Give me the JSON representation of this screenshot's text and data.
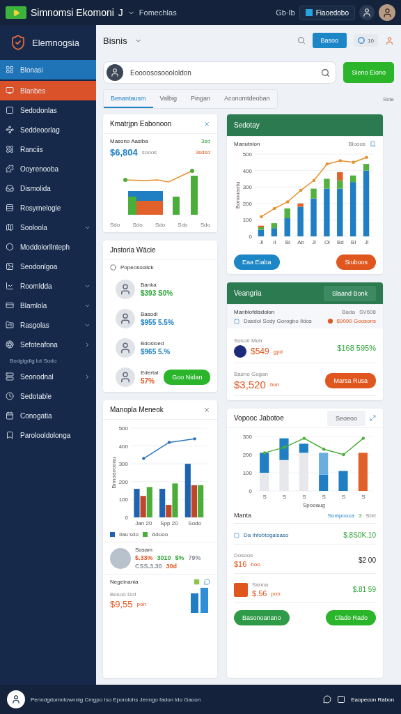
{
  "topbar": {
    "title": "Simnomsi Ekomoni",
    "suffix": "J",
    "subtitle": "Fomechlas",
    "status": "Gb·Ib",
    "action": "Fiaoedobo"
  },
  "sidebar": {
    "brand": "Elemnogsia",
    "items": [
      {
        "label": "Blonasi",
        "selected": true,
        "highlighted": false
      },
      {
        "label": "Blanbes",
        "selected": false,
        "highlighted": true
      },
      {
        "label": "Sedodonlas",
        "selected": false,
        "highlighted": false
      },
      {
        "label": "Seddeoorlag",
        "selected": false,
        "highlighted": false
      },
      {
        "label": "Ranciis",
        "selected": false,
        "highlighted": false
      },
      {
        "label": "Ooyrenooba",
        "selected": false,
        "highlighted": false
      },
      {
        "label": "Dismolida",
        "selected": false,
        "highlighted": false
      },
      {
        "label": "Rosyrnelogle",
        "selected": false,
        "highlighted": false
      },
      {
        "label": "Sooloola",
        "selected": false,
        "highlighted": false,
        "expanded": true
      },
      {
        "label": "Moddolorllnteph",
        "selected": false,
        "highlighted": false
      },
      {
        "label": "Seodonlgoa",
        "selected": false,
        "highlighted": false
      },
      {
        "label": "Roomldda",
        "selected": false,
        "highlighted": false,
        "expanded": true
      },
      {
        "label": "Blamlola",
        "selected": false,
        "highlighted": false,
        "expanded": true
      },
      {
        "label": "Rasgolas",
        "selected": false,
        "highlighted": false,
        "expanded": true
      },
      {
        "label": "Sefoteafona",
        "selected": false,
        "highlighted": false,
        "expanded": false
      },
      {
        "label": "Bodgigdlg lut Sodo",
        "selected": false,
        "highlighted": false,
        "kind": "sub"
      },
      {
        "label": "Seonodnal",
        "selected": false,
        "highlighted": false,
        "expanded": false
      },
      {
        "label": "Sedotable",
        "selected": false,
        "highlighted": false
      },
      {
        "label": "Conogatia",
        "selected": false,
        "highlighted": false
      },
      {
        "label": "Parolooldolonga",
        "selected": false,
        "highlighted": false
      }
    ]
  },
  "header": {
    "title": "Bisnis",
    "button": "Basoo",
    "toggle_count": "10"
  },
  "search": {
    "placeholder": "Eoooososooololdon",
    "button": "Sieno Eiono"
  },
  "tabs": [
    {
      "label": "Benantausm",
      "selected": true
    },
    {
      "label": "Valbig",
      "selected": false
    },
    {
      "label": "Pingan",
      "selected": false
    },
    {
      "label": "Aconomtdeoban",
      "selected": false
    }
  ],
  "tabs_side": "Side",
  "summary_card": {
    "title": "Kmatrjpn Eabonoon",
    "label": "Masono Aasiba",
    "amount": "$6,804",
    "amount_note": "sooos",
    "badge_top": "3sd",
    "badge_bottom": "3sdsd",
    "x_labels": [
      "Sdo",
      "Sdo",
      "Sdo",
      "Sdo",
      "Sdo"
    ]
  },
  "people_card": {
    "title": "Jnstoria Wäcie",
    "filter": "Popeosoolick",
    "people": [
      {
        "name": "Banka",
        "value": "$393 S0%",
        "color": "#2ba334"
      },
      {
        "name": "Basodi",
        "value": "$955 5.5%",
        "color": "#1d7fc4"
      },
      {
        "name": "Bdosloed",
        "value": "$965 5.%",
        "color": "#1d7fc4"
      },
      {
        "name": "Edertal",
        "value": "57%",
        "color": "#e0561f",
        "button": "Goo Nidan"
      }
    ]
  },
  "chart_card": {
    "title": "Manopla Meneok",
    "chart_data": {
      "type": "bar",
      "ylabel": "Bnnoaoooau",
      "categories": [
        "Jan 20",
        "Spp 20",
        "Sodo"
      ],
      "ylim": [
        0,
        500
      ],
      "yticks": [
        0,
        100,
        200,
        300,
        400,
        500
      ],
      "grid": true,
      "series": [
        {
          "name": "Ilau sdo",
          "color": "#1d63b0",
          "values": [
            160,
            160,
            300
          ]
        },
        {
          "color": "#c0462a",
          "values": [
            120,
            70,
            180
          ]
        },
        {
          "name": "Aduoo",
          "color": "#4cae3a",
          "values": [
            170,
            190,
            180
          ]
        },
        {
          "color": "#2a74b8",
          "values": [
            330,
            420,
            440
          ],
          "type": "line"
        }
      ]
    },
    "item": {
      "title": "Sosam",
      "line1": [
        {
          "text": "$.33%",
          "color": "#e0561f"
        },
        {
          "text": "3010",
          "color": "#2ba334"
        },
        {
          "text": "$%",
          "color": "#2ba334"
        },
        {
          "text": "79%",
          "color": "#8a8f98"
        }
      ],
      "line2": [
        {
          "text": "CSS.3.30",
          "color": "#8a8f98"
        },
        {
          "text": "30d",
          "color": "#e0561f"
        }
      ]
    },
    "mini": {
      "title": "Negeinania",
      "label": "Bosoo Dot",
      "amount": "$9,55",
      "unit": "pon"
    }
  },
  "trend_card": {
    "title": "Sedotay",
    "subtitle": "Manutnlon",
    "filter": "Blooos",
    "chart_data": {
      "type": "bar",
      "ylabel": "Bonnoaotu",
      "categories": [
        "Jl",
        "Il",
        "Bl",
        "Ab",
        "Jl",
        "Ol",
        "Bd",
        "Bl",
        "Jl"
      ],
      "ylim": [
        0,
        500
      ],
      "yticks": [
        0,
        100,
        200,
        300,
        400,
        500
      ],
      "grid": true,
      "stacked": true,
      "series": [
        {
          "color": "#1f7fc2",
          "values": [
            40,
            50,
            110,
            180,
            230,
            290,
            290,
            330,
            400
          ]
        },
        {
          "color": "#54b03f",
          "values": [
            15,
            30,
            60,
            0,
            60,
            60,
            50,
            40,
            40
          ]
        },
        {
          "color": "#e2612a",
          "values": [
            10,
            0,
            0,
            20,
            0,
            0,
            50,
            0,
            0
          ]
        },
        {
          "color": "#e88f2a",
          "values": [
            120,
            170,
            210,
            280,
            340,
            440,
            460,
            450,
            480
          ],
          "type": "line"
        }
      ]
    },
    "buttons": [
      {
        "label": "Eaa Eiaba",
        "color": "#1d86c6"
      },
      {
        "label": "Siuboos",
        "color": "#e0561f"
      }
    ]
  },
  "finance_card": {
    "title": "Veangria",
    "button": "Slaand Bonk",
    "section": "Manblofdisdolon",
    "col_a": "Bada",
    "col_b": "SV608",
    "note": "Dasdol Sody Gorogbo Ildos",
    "status": "$9090 Goosons",
    "rows": [
      {
        "kind": "value",
        "caption": "Sosoir Moh",
        "amount": "$549",
        "unit": "gpd",
        "right": "$168 595%"
      },
      {
        "kind": "action",
        "caption": "Basno Gogan",
        "amount": "$3,520",
        "unit": "bun",
        "button": "Marsa Rusa"
      }
    ]
  },
  "compare_card": {
    "title": "Vopooc Jabotoe",
    "button": "Seoeoo",
    "chart_data": {
      "type": "bar",
      "categories": [
        "S",
        "S",
        "S",
        "S",
        "S",
        "S"
      ],
      "xlabel": "Spooaug",
      "ylim": [
        0,
        300
      ],
      "yticks": [
        0,
        100,
        200,
        300
      ],
      "grid": true,
      "stacked": true,
      "series": [
        {
          "color": "#e6e8ec",
          "values": [
            100,
            170,
            210,
            0,
            0,
            0
          ]
        },
        {
          "color": "#1f7fc2",
          "values": [
            110,
            120,
            50,
            90,
            110,
            0
          ]
        },
        {
          "color": "#6aaede",
          "values": [
            0,
            0,
            0,
            120,
            0,
            0
          ]
        },
        {
          "color": "#e2612a",
          "values": [
            0,
            0,
            0,
            0,
            0,
            210
          ]
        },
        {
          "color": "#4cae3a",
          "values": [
            210,
            240,
            290,
            230,
            200,
            290
          ],
          "type": "line"
        }
      ]
    },
    "list_title": "Manta",
    "list_link": "Sompooca",
    "list_count": "3",
    "list_side": "Sbrt",
    "rows": [
      {
        "kind": "link",
        "label": "Da Ihfobtogalsaso",
        "right": "$.8S0K.10"
      },
      {
        "kind": "value",
        "caption": "Dosoos",
        "amount": "$16",
        "unit": "boo",
        "right": "$2 00"
      },
      {
        "kind": "image",
        "caption": "Sanna",
        "amount": "$.56",
        "unit": "pon",
        "right": "$.81 59"
      }
    ],
    "buttons": [
      {
        "label": "Basonoanano",
        "color": "#2f9a47"
      },
      {
        "label": "Clado Rado",
        "color": "#2bb52b"
      }
    ]
  },
  "footer": {
    "text": "Penndgdomntownnig Cmgpo Iso Eporolohs Jenngo fadon ldo Gaoon",
    "action": "Eaopecon Rabon"
  }
}
